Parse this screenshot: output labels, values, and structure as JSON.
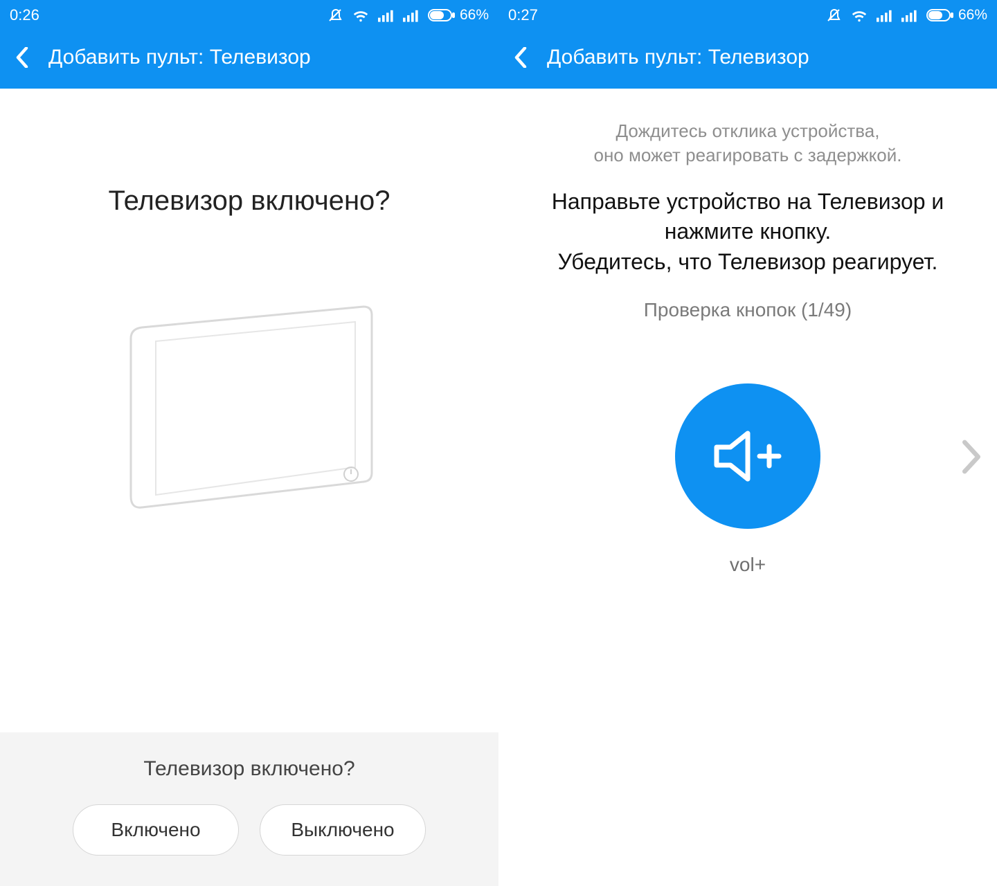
{
  "left": {
    "status": {
      "time": "0:26",
      "battery": "66%"
    },
    "header": {
      "title": "Добавить пульт: Телевизор"
    },
    "question": "Телевизор включено?",
    "panel": {
      "title": "Телевизор включено?",
      "on_label": "Включено",
      "off_label": "Выключено"
    }
  },
  "right": {
    "status": {
      "time": "0:27",
      "battery": "66%"
    },
    "header": {
      "title": "Добавить пульт: Телевизор"
    },
    "hint": "Дождитесь отклика устройства,\nоно может реагировать с задержкой.",
    "instruction": "Направьте устройство на Телевизор и\nнажмите кнопку.\nУбедитесь, что Телевизор реагирует.",
    "check_label": "Проверка кнопок (1/49)",
    "button_label": "vol+",
    "check_current": 1,
    "check_total": 49
  },
  "colors": {
    "accent": "#0e91f2"
  }
}
